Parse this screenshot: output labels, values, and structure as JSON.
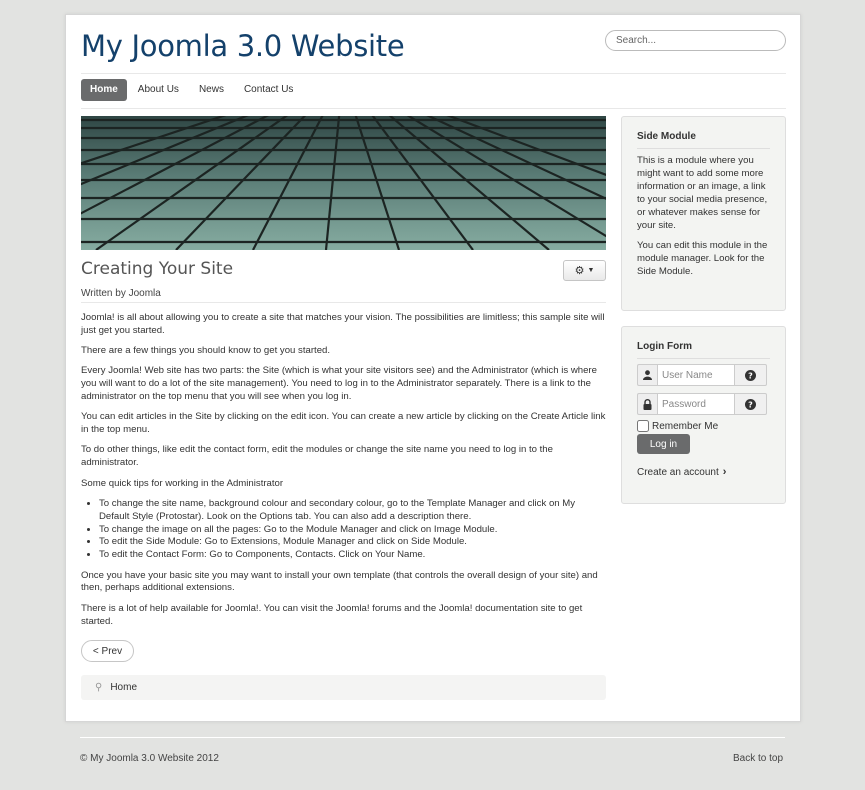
{
  "header": {
    "site_title": "My Joomla 3.0 Website",
    "search_placeholder": "Search..."
  },
  "nav": {
    "items": [
      "Home",
      "About Us",
      "News",
      "Contact Us"
    ],
    "active": "Home"
  },
  "article": {
    "title": "Creating Your Site",
    "written_by": "Written by Joomla",
    "paragraphs": [
      "Joomla! is all about allowing you to create a site that matches your vision. The possibilities are limitless; this sample site will just get you started.",
      "There are a few things you should know to get you started.",
      "Every Joomla! Web site has two parts: the Site (which is what your site visitors see) and the Administrator (which is where you will want to do a lot of the site management). You need to log in to the Administrator separately. There is a link to the administrator on the top menu that you will see when you log in.",
      "You can edit articles in the Site by clicking on the edit icon. You can create a new article by clicking on the Create Article link in the top menu.",
      "To do other things, like edit the contact form, edit the modules or change the site name you need to log in to the administrator.",
      "Some quick tips for working in the Administrator"
    ],
    "tips": [
      "To change the site name, background colour and secondary colour, go to the Template Manager and click on My Default Style (Protostar). Look on the Options tab. You can also add a description there.",
      "To change the image on all the pages: Go to the Module Manager and click on Image Module.",
      "To edit the Side Module: Go to Extensions, Module Manager and click on Side Module.",
      "To edit the Contact Form: Go to Components, Contacts. Click on Your Name."
    ],
    "closing": [
      "Once you have your basic site you may want to install your own template (that controls the overall design of your site) and then, perhaps additional extensions.",
      "There is a lot of help available for Joomla!. You can visit the Joomla! forums and the Joomla! documentation site to get started."
    ],
    "prev_label": "< Prev"
  },
  "breadcrumbs": {
    "items": [
      "Home"
    ]
  },
  "side_module": {
    "title": "Side Module",
    "paragraphs": [
      "This is a module where you might want to add some more information or an image, a link to your social media presence, or whatever makes sense for your site.",
      "You can edit this module in the module manager. Look for the Side Module."
    ]
  },
  "login_form": {
    "title": "Login Form",
    "username_placeholder": "User Name",
    "password_placeholder": "Password",
    "remember_label": "Remember Me",
    "login_label": "Log in",
    "create_account_label": "Create an account"
  },
  "footer": {
    "copyright": "© My Joomla 3.0 Website 2012",
    "back_to_top": "Back to top"
  },
  "colors": {
    "background": "#e2e3e1",
    "title": "#14416b",
    "nav_active": "#6a6b6c",
    "module_bg": "#f3f4f2"
  }
}
